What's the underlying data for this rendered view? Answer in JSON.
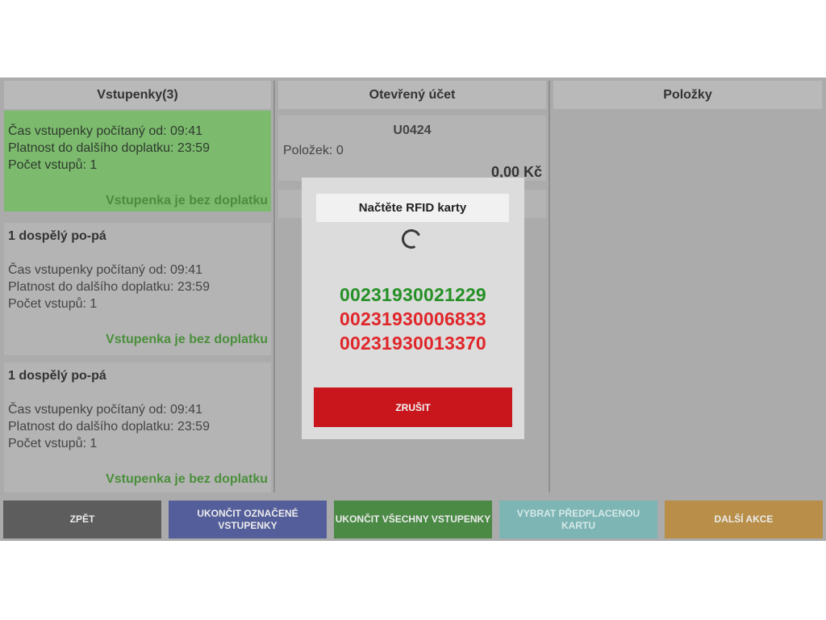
{
  "tickets": {
    "header": "Vstupenky(3)",
    "cards": [
      {
        "title": "",
        "time_from": "Čas vstupenky počítaný od: 09:41",
        "valid_until": "Platnost do dalšího doplatku: 23:59",
        "entries": "Počet vstupů: 1",
        "status": "Vstupenka je bez doplatku"
      },
      {
        "title": "1 dospělý po-pá",
        "time_from": "Čas vstupenky počítaný od: 09:41",
        "valid_until": "Platnost do dalšího doplatku: 23:59",
        "entries": "Počet vstupů: 1",
        "status": "Vstupenka je bez doplatku"
      },
      {
        "title": "1 dospělý po-pá",
        "time_from": "Čas vstupenky počítaný od: 09:41",
        "valid_until": "Platnost do dalšího doplatku: 23:59",
        "entries": "Počet vstupů: 1",
        "status": "Vstupenka je bez doplatku"
      }
    ]
  },
  "account": {
    "header": "Otevřený účet",
    "code": "U0424",
    "items_label": "Položek: 0",
    "total": "0,00 Kč"
  },
  "items_panel": {
    "header": "Položky"
  },
  "dialog": {
    "title": "Načtěte RFID karty",
    "cards": [
      {
        "number": "00231930021229",
        "color": "#259025"
      },
      {
        "number": "00231930006833",
        "color": "#e0262a"
      },
      {
        "number": "00231930013370",
        "color": "#e0262a"
      }
    ],
    "cancel_label": "ZRUŠIT"
  },
  "footer": {
    "back": "ZPĚT",
    "end_selected": "UKONČIT OZNAČENÉ VSTUPENKY",
    "end_all": "UKONČIT VŠECHNY VSTUPENKY",
    "select_prepaid": "VYBRAT PŘEDPLACENOU KARTU",
    "more_actions": "DALŠÍ AKCE"
  },
  "colors": {
    "back": "#5d5d5d",
    "end_selected": "#545e9a",
    "end_all": "#4b8a45",
    "select_prepaid": "#7db4b4",
    "more_actions": "#b88e48",
    "active_card": "#7cbb6e",
    "cancel": "#c8161c"
  }
}
